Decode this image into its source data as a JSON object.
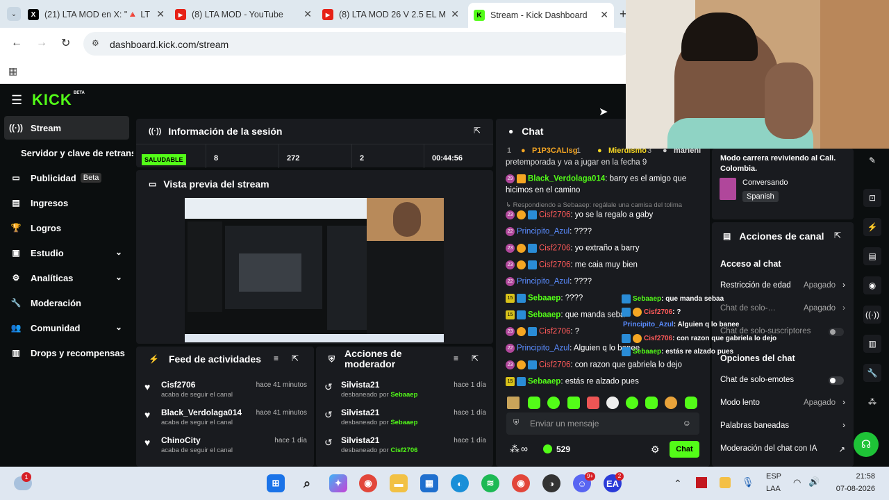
{
  "browser": {
    "tabs": [
      {
        "title": "(21) LTA MOD en X: \"🔺 LT",
        "favicon": "X"
      },
      {
        "title": "(8) LTA MOD - YouTube",
        "favicon": "▶"
      },
      {
        "title": "(8) LTA MOD 26 V 2.5 EL M",
        "favicon": "▶"
      },
      {
        "title": "Stream - Kick Dashboard",
        "favicon": "K"
      }
    ],
    "url": "dashboard.kick.com/stream"
  },
  "kick": {
    "logo": "KICK",
    "logo_badge": "BETA"
  },
  "sidebar": {
    "items": [
      {
        "label": "Stream",
        "icon": "stream-icon"
      },
      {
        "label": "Servidor y clave de retransmisión",
        "icon": ""
      },
      {
        "label": "Publicidad",
        "icon": "ads-icon",
        "badge": "Beta"
      },
      {
        "label": "Ingresos",
        "icon": "revenue-icon"
      },
      {
        "label": "Logros",
        "icon": "trophy-icon"
      },
      {
        "label": "Estudio",
        "icon": "studio-icon"
      },
      {
        "label": "Analíticas",
        "icon": "analytics-icon"
      },
      {
        "label": "Moderación",
        "icon": "moderation-icon"
      },
      {
        "label": "Comunidad",
        "icon": "community-icon"
      },
      {
        "label": "Drops y recompensas",
        "icon": "drops-icon"
      }
    ]
  },
  "session": {
    "title": "Información de la sesión",
    "status": "SALUDABLE",
    "stats": [
      "8",
      "272",
      "2",
      "00:44:56"
    ]
  },
  "preview": {
    "title": "Vista previa del stream"
  },
  "feed": {
    "title": "Feed de actividades",
    "items": [
      {
        "name": "Cisf2706",
        "time": "hace 41 minutos",
        "desc": "acaba de seguir el canal"
      },
      {
        "name": "Black_Verdolaga014",
        "time": "hace 41 minutos",
        "desc": "acaba de seguir el canal"
      },
      {
        "name": "ChinoCity",
        "time": "hace 1 día",
        "desc": "acaba de seguir el canal"
      }
    ]
  },
  "modactions": {
    "title": "Acciones de moderador",
    "items": [
      {
        "name": "Silvista21",
        "time": "hace 1 día",
        "desc": "desbaneado por",
        "by": "Sebaaep"
      },
      {
        "name": "Silvista21",
        "time": "hace 1 día",
        "desc": "desbaneado por",
        "by": "Sebaaep"
      },
      {
        "name": "Silvista21",
        "time": "hace 1 día",
        "desc": "desbaneado por",
        "by": "Cisf2706"
      }
    ]
  },
  "chat": {
    "title": "Chat",
    "top_gifters": [
      {
        "rank": "1",
        "name": "P1P3CALIsg",
        "count": "1"
      },
      {
        "rank": "",
        "name": "Mierdismo",
        "count": "3"
      },
      {
        "rank": "",
        "name": "marienl",
        "count": ""
      }
    ],
    "partial_line": "pretemporada y va a jugar en la fecha 9",
    "reply_line": "Respondiendo a Sebaaep: regálale una camisa del tolima",
    "messages": [
      {
        "badge": "29",
        "user": "Black_Verdolaga014",
        "text": ": barry es el amigo que",
        "color": "#53fc18"
      },
      {
        "badge": "",
        "user": "",
        "text": "hicimos en el camino",
        "color": "#fff"
      },
      {
        "badge": "23",
        "user": "Cisf2706",
        "text": ": yo se la regalo a gaby",
        "color": "#ff5a5a"
      },
      {
        "badge": "22",
        "user": "Principito_Azul",
        "text": ": ????",
        "color": "#5a8cff"
      },
      {
        "badge": "23",
        "user": "Cisf2706",
        "text": ": yo extraño a barry",
        "color": "#ff5a5a"
      },
      {
        "badge": "23",
        "user": "Cisf2706",
        "text": ": me caia muy bien",
        "color": "#ff5a5a"
      },
      {
        "badge": "22",
        "user": "Principito_Azul",
        "text": ": ????",
        "color": "#5a8cff"
      },
      {
        "badge": "15",
        "user": "Sebaaep",
        "text": ": ????",
        "color": "#53fc18"
      },
      {
        "badge": "15",
        "user": "Sebaaep",
        "text": ": que manda seba",
        "color": "#53fc18"
      },
      {
        "badge": "23",
        "user": "Cisf2706",
        "text": ": ?",
        "color": "#ff5a5a"
      },
      {
        "badge": "22",
        "user": "Principito_Azul",
        "text": ": Alguien q lo banee",
        "color": "#5a8cff"
      },
      {
        "badge": "23",
        "user": "Cisf2706",
        "text": ": con razon que gabriela lo dejo",
        "color": "#ff5a5a"
      },
      {
        "badge": "15",
        "user": "Sebaaep",
        "text": ": estás re alzado pues",
        "color": "#53fc18"
      }
    ],
    "placeholder": "Enviar un mensaje",
    "viewers": "529",
    "send_label": "Chat",
    "infinity": "∞"
  },
  "overlay_chat": [
    {
      "user": "Sebaaep",
      "text": ": que manda sebaa",
      "color": "#53fc18"
    },
    {
      "user": "Cisf2706",
      "text": ": ?",
      "color": "#ff5a5a"
    },
    {
      "user": "Principito_Azul",
      "text": ": Alguien q lo banee",
      "color": "#5a8cff"
    },
    {
      "user": "Cisf2706",
      "text": ": con razon que gabriela lo dejo",
      "color": "#ff5a5a"
    },
    {
      "user": "Sebaaep",
      "text": ": estás re alzado pues",
      "color": "#53fc18"
    }
  ],
  "stream_info": {
    "title": "Modo carrera reviviendo al Cali. Colombia.",
    "category": "Conversando",
    "language": "Spanish"
  },
  "channel_actions": {
    "title": "Acciones de canal",
    "section1": "Acceso al chat",
    "rows": [
      {
        "label": "Restricción de edad",
        "value": "Apagado"
      },
      {
        "label": "Chat de solo-…",
        "value": "Apagado"
      },
      {
        "label": "Chat de solo-suscriptores",
        "value": ""
      }
    ],
    "section2": "Opciones del chat",
    "rows2": [
      {
        "label": "Chat de solo-emotes",
        "value": ""
      },
      {
        "label": "Modo lento",
        "value": "Apagado"
      },
      {
        "label": "Palabras baneadas",
        "value": ""
      },
      {
        "label": "Moderación del chat con IA",
        "value": ""
      }
    ]
  },
  "taskbar": {
    "lang": "ESP",
    "layout": "LAA",
    "time": "21:58",
    "date": "07-08-2026",
    "weather_badge": "1",
    "ea_badge": "2",
    "discord_badge": "9+"
  },
  "colors": {
    "kick_green": "#53fc18",
    "panel": "#191b1f",
    "bg": "#0b0e0f"
  }
}
